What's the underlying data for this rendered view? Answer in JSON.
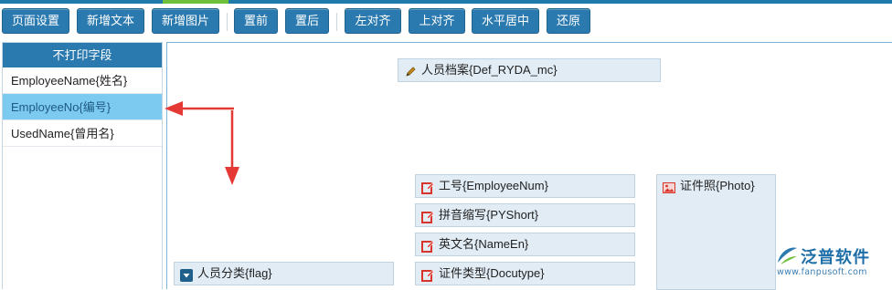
{
  "toolbar": {
    "buttons": [
      {
        "label": "页面设置"
      },
      {
        "label": "新增文本"
      },
      {
        "label": "新增图片"
      },
      {
        "label": "置前"
      },
      {
        "label": "置后"
      },
      {
        "label": "左对齐"
      },
      {
        "label": "上对齐"
      },
      {
        "label": "水平居中"
      },
      {
        "label": "还原"
      }
    ]
  },
  "left_panel": {
    "title": "不打印字段",
    "items": [
      {
        "label": "EmployeeName{姓名}",
        "selected": false
      },
      {
        "label": "EmployeeNo{编号}",
        "selected": true
      },
      {
        "label": "UsedName{曾用名}",
        "selected": false
      }
    ]
  },
  "designer": {
    "fields": [
      {
        "label": "人员档案{Def_RYDA_mc}",
        "icon": "pencil-icon"
      },
      {
        "label": "工号{EmployeeNum}",
        "icon": "edit-icon"
      },
      {
        "label": "拼音缩写{PYShort}",
        "icon": "edit-icon"
      },
      {
        "label": "英文名{NameEn}",
        "icon": "edit-icon"
      },
      {
        "label": "证件类型{Docutype}",
        "icon": "edit-icon"
      },
      {
        "label": "人员分类{flag}",
        "icon": "dropdown-icon"
      },
      {
        "label": "证件照{Photo}",
        "icon": "image-icon"
      }
    ]
  },
  "watermark": {
    "name": "泛普软件",
    "url": "www.fanpusoft.com"
  },
  "colors": {
    "toolbar_button": "#2a7ab0",
    "selected_row": "#7ccaf0",
    "field_bg": "#e1ecf5",
    "edit_icon": "#d9342b",
    "arrow": "#e53935"
  }
}
